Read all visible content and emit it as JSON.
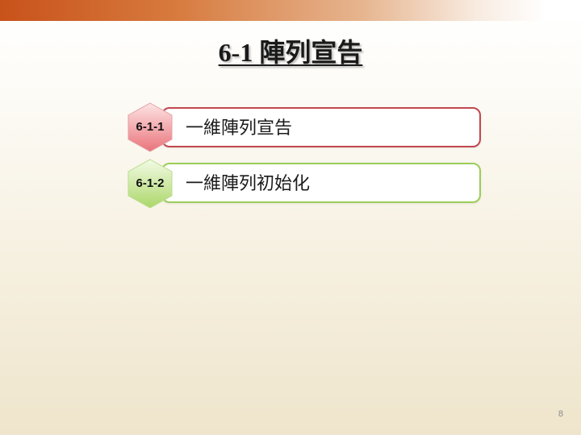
{
  "slide": {
    "title": "6-1 陣列宣告",
    "page_number": "8"
  },
  "items": [
    {
      "badge": "6-1-1",
      "label": "一維陣列宣告",
      "accent": "#c2474f",
      "badge_fill_top": "#fde4e4",
      "badge_fill_bottom": "#e9747b"
    },
    {
      "badge": "6-1-2",
      "label": "一維陣列初始化",
      "accent": "#9ccd5a",
      "badge_fill_top": "#f3fbe6",
      "badge_fill_bottom": "#acd76a"
    }
  ]
}
